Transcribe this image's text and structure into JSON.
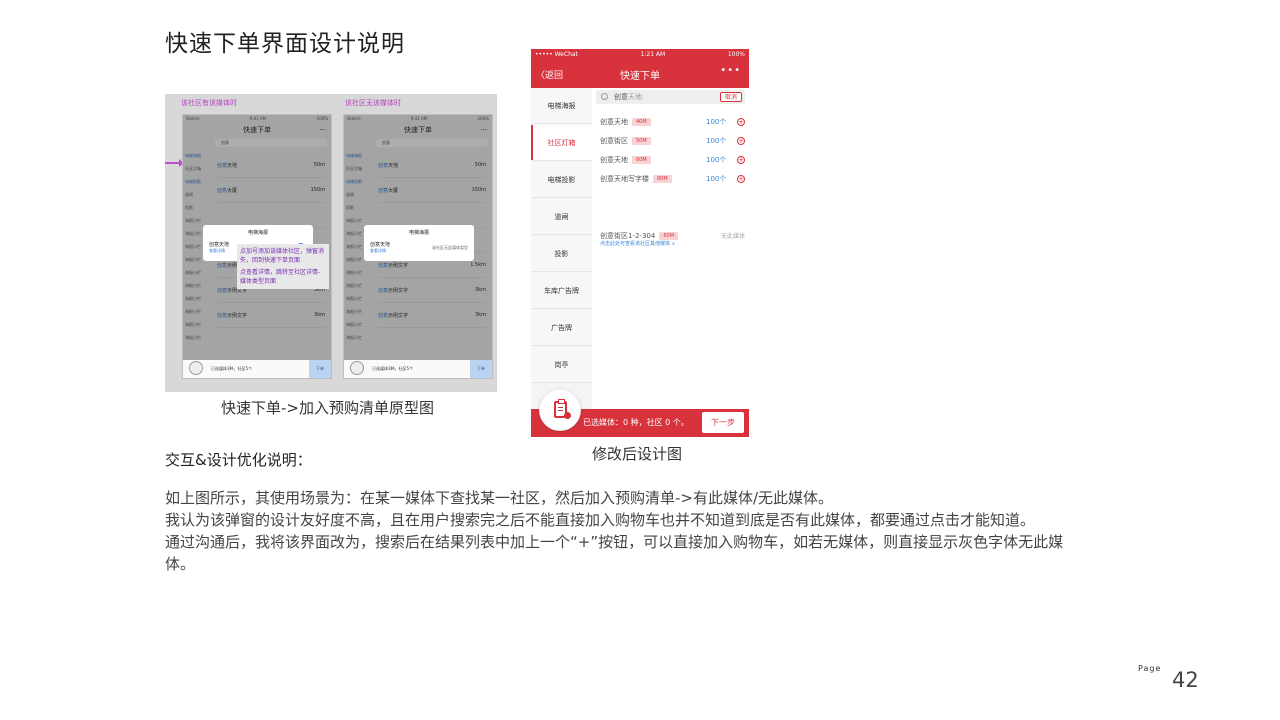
{
  "page_title": "快速下单界面设计说明",
  "prototype": {
    "label_left": "该社区有该媒体时",
    "label_right": "该社区无该媒体时",
    "status_carrier": "Sketch",
    "status_time": "9:41 AM",
    "status_battery": "100%",
    "screen_title": "快速下单",
    "search_text": "创意",
    "search_cancel": "取消",
    "left_items": [
      "电梯海报",
      "社区灯箱",
      "电梯投影",
      "道闸",
      "投影",
      "海报小栏",
      "海报小栏",
      "海报小栏",
      "海报小栏",
      "海报小栏",
      "海报小栏",
      "海报小栏",
      "海报小栏",
      "海报小栏",
      "海报小栏"
    ],
    "rows_left": [
      {
        "prefix": "创意",
        "name": "天地",
        "dist": "50m"
      },
      {
        "prefix": "创意",
        "name": "大厦",
        "dist": "150m"
      },
      {
        "prefix": "",
        "name": "",
        "dist": ""
      },
      {
        "prefix": "",
        "name": "",
        "dist": ""
      },
      {
        "prefix": "创意",
        "name": "示例文字",
        "dist": "1.5km"
      },
      {
        "prefix": "创意",
        "name": "示例文字",
        "dist": "3km"
      },
      {
        "prefix": "创意",
        "name": "示例文字",
        "dist": "3km"
      }
    ],
    "rows_right": [
      {
        "prefix": "创意",
        "name": "天地",
        "dist": "50m"
      },
      {
        "prefix": "创意",
        "name": "大厦",
        "dist": "150m"
      },
      {
        "prefix": "",
        "name": "",
        "dist": ""
      },
      {
        "prefix": "",
        "name": "",
        "dist": ""
      },
      {
        "prefix": "创意",
        "name": "示例文字",
        "dist": "1.5km"
      },
      {
        "prefix": "创意",
        "name": "示例文字",
        "dist": "3km"
      },
      {
        "prefix": "创意",
        "name": "示例文字",
        "dist": "3km"
      }
    ],
    "popup_title": "电梯海报",
    "popup_name": "创意天地",
    "popup_link": "查看详情",
    "popup_right_text": "该社区无此媒体类型",
    "bottom_text": "已选媒体3种，社区5个",
    "bottom_button": "下单",
    "note_line1": "点加号添加该媒体社区，弹窗消失，回到快速下单页面",
    "note_line2": "点查看详情，跳转至社区详情-媒体类型页面"
  },
  "caption_left": "快速下单->加入预购清单原型图",
  "phone": {
    "status_carrier": "••••• WeChat",
    "status_time": "1:21 AM",
    "status_battery": "100%",
    "back": "〈返回",
    "title": "快速下单",
    "more": "•••",
    "sidebar": [
      "电梯海报",
      "社区灯箱",
      "电梯投影",
      "道闸",
      "投影",
      "车库广告牌",
      "广告牌",
      "岗亭"
    ],
    "search_prefix": "创意",
    "search_rest": "天地",
    "search_cancel": "取消",
    "results": [
      {
        "name": "创意天地",
        "tag": "40M",
        "count": "100个"
      },
      {
        "name": "创意街区",
        "tag": "50M",
        "count": "100个"
      },
      {
        "name": "创意天地",
        "tag": "60M",
        "count": "100个"
      },
      {
        "name": "创意天地写字楼",
        "tag": "80M",
        "count": "100个"
      }
    ],
    "no_media_row": {
      "name": "创意街区1-2-304",
      "tag": "60M",
      "status": "无此媒体"
    },
    "no_media_hint": "点击此处可查看该社区其他媒体 ∨",
    "bottom_text": "已选媒体：0 种，社区 0 个。",
    "next_button": "下一步"
  },
  "caption_right": "修改后设计图",
  "section_heading": "交互&设计优化说明：",
  "paragraphs": [
    "如上图所示，其使用场景为：在某一媒体下查找某一社区，然后加入预购清单->有此媒体/无此媒体。",
    "我认为该弹窗的设计友好度不高，且在用户搜索完之后不能直接加入购物车也并不知道到底是否有此媒体，都要通过点击才能知道。",
    "通过沟通后，我将该界面改为，搜索后在结果列表中加上一个“+”按钮，可以直接加入购物车，如若无媒体，则直接显示灰色字体无此媒体。"
  ],
  "page_label": "Page",
  "page_number": "42",
  "colors": {
    "accent_red": "#d8323c",
    "link_blue": "#3a86d8",
    "note_purple": "#b63fbf"
  }
}
